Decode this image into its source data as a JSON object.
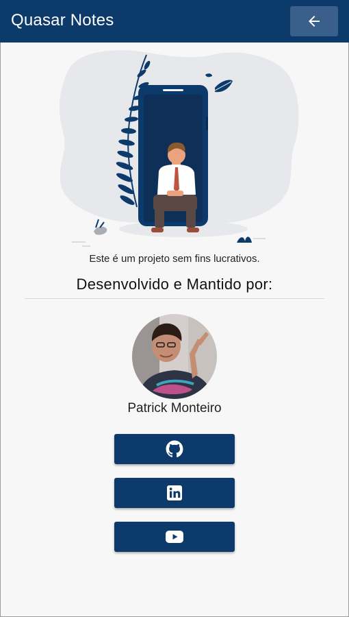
{
  "app": {
    "title": "Quasar Notes"
  },
  "about": {
    "tagline": "Este é um projeto sem fins lucrativos.",
    "heading": "Desenvolvido e Mantido por:",
    "developer_name": "Patrick Monteiro"
  },
  "social": [
    {
      "icon": "github-icon"
    },
    {
      "icon": "linkedin-icon"
    },
    {
      "icon": "youtube-icon"
    }
  ],
  "colors": {
    "primary": "#0c3a6b",
    "header_button": "#3a5f8a",
    "background": "#f7f7f7"
  }
}
